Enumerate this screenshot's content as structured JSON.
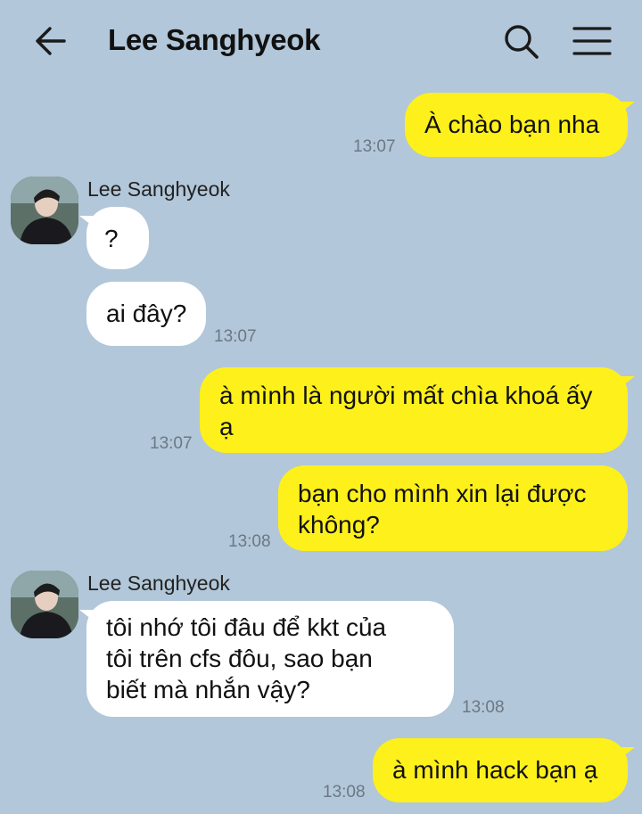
{
  "header": {
    "title": "Lee Sanghyeok",
    "icons": [
      "back-arrow-icon",
      "search-icon",
      "menu-icon"
    ]
  },
  "colors": {
    "background": "#b2c7d9",
    "my_bubble": "#fef01b",
    "their_bubble": "#ffffff"
  },
  "messages": [
    {
      "from": "me",
      "lines": [
        "À chào bạn nha"
      ],
      "time": "13:07"
    },
    {
      "from": "them",
      "sender": "Lee Sanghyeok",
      "lines": [
        "?"
      ]
    },
    {
      "from": "them",
      "lines": [
        "ai đây?"
      ],
      "time": "13:07"
    },
    {
      "from": "me",
      "lines": [
        "à mình là người mất chìa khoá ấy",
        "ạ"
      ],
      "time": "13:07"
    },
    {
      "from": "me",
      "lines": [
        "bạn cho mình xin lại được",
        "không?"
      ],
      "time": "13:08"
    },
    {
      "from": "them",
      "sender": "Lee Sanghyeok",
      "lines": [
        "tôi nhớ tôi đâu để kkt của",
        "tôi trên cfs đôu, sao bạn",
        "biết mà nhắn vậy?"
      ],
      "time": "13:08"
    },
    {
      "from": "me",
      "lines": [
        "à mình hack bạn ạ"
      ],
      "time": "13:08"
    }
  ]
}
